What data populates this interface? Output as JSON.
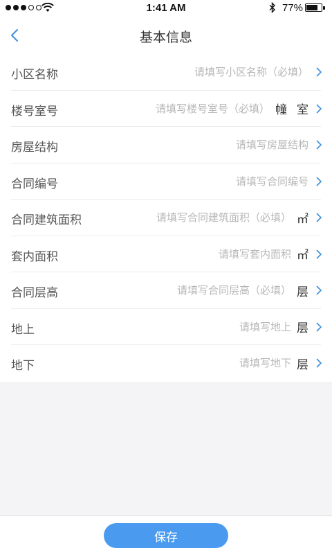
{
  "status_bar": {
    "time": "1:41 AM",
    "battery_percent": "77%",
    "battery_level": 0.77,
    "signal_bars_filled": 3,
    "signal_bars_total": 5
  },
  "header": {
    "title": "基本信息",
    "back_icon": "chevron-left-icon"
  },
  "form": {
    "rows": [
      {
        "label": "小区名称",
        "placeholder": "请填写小区名称（必填）"
      },
      {
        "label": "楼号室号",
        "placeholder": "请填写楼号室号（必填）",
        "unit": "幢",
        "unit2": "室"
      },
      {
        "label": "房屋结构",
        "placeholder": "请填写房屋结构"
      },
      {
        "label": "合同编号",
        "placeholder": "请填写合同编号"
      },
      {
        "label": "合同建筑面积",
        "placeholder": "请填写合同建筑面积（必填）",
        "unit": "㎡"
      },
      {
        "label": "套内面积",
        "placeholder": "请填写套内面积",
        "unit": "㎡"
      },
      {
        "label": "合同层高",
        "placeholder": "请填写合同层高（必填）",
        "unit": "层"
      },
      {
        "label": "地上",
        "placeholder": "请填写地上",
        "unit": "层"
      },
      {
        "label": "地下",
        "placeholder": "请填写地下",
        "unit": "层"
      }
    ]
  },
  "footer": {
    "save_label": "保存"
  },
  "colors": {
    "accent": "#4a9bf0",
    "chevron": "#3d8fe0",
    "background": "#f4f4f6"
  }
}
